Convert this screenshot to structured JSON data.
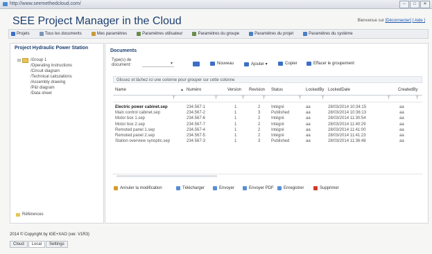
{
  "browser": {
    "url": "http://www.seemethedcloud.com/"
  },
  "window_buttons": [
    "–",
    "□",
    "✕"
  ],
  "app": {
    "title": "SEE Project Manager in the Cloud"
  },
  "welcome": {
    "text": "Bienvenue sur ",
    "user": "[Déconnecter]",
    "logout": "[ Aide ]"
  },
  "menu": [
    {
      "label": "Projets",
      "icon": "projects-icon",
      "color": "#3b6fc7"
    },
    {
      "label": "Tous les documents",
      "icon": "documents-icon",
      "color": "#7b95b8"
    },
    {
      "label": "Mes paramètres",
      "icon": "user-settings-icon",
      "color": "#c89b3b"
    },
    {
      "label": "Paramètres utilisateur",
      "icon": "user-params-icon",
      "color": "#6a8c48"
    },
    {
      "label": "Paramètres du groupe",
      "icon": "group-params-icon",
      "color": "#6a8c48"
    },
    {
      "label": "Paramètres du projet",
      "icon": "project-params-icon",
      "color": "#4b7fc4"
    },
    {
      "label": "Paramètres du système",
      "icon": "system-params-icon",
      "color": "#4b7fc4"
    }
  ],
  "left": {
    "header": "Project Hydraulic Power Station",
    "group": "/Group 1",
    "items": [
      "/Operating instructions",
      "/Circuit diagram",
      "/Technical calculations",
      "/Assembly drawing",
      "/P&I diagram",
      "/Data sheet"
    ],
    "references": "Références"
  },
  "docs": {
    "header": "Documents",
    "type_label": "Type(s) de document:",
    "type_value": "",
    "toolbar": [
      {
        "label": "",
        "icon": "view-icon",
        "color": "#3b6fc7"
      },
      {
        "label": "Nouveau",
        "icon": "new-icon",
        "color": "#3b6fc7"
      },
      {
        "label": "Ajouter ▾",
        "icon": "add-icon",
        "color": "#3b6fc7"
      },
      {
        "label": "Copier",
        "icon": "copy-icon",
        "color": "#3b6fc7"
      },
      {
        "label": "Effacer le groupement",
        "icon": "clear-grouping-icon",
        "color": "#3b6fc7"
      }
    ],
    "group_hint": "Glissez et lâchez ici une colonne pour grouper sur cette colonne",
    "columns": [
      "Name",
      "Numéro",
      "Version",
      "Revision",
      "Status",
      "LockedBy",
      "LockedDate",
      "CreatedBy"
    ],
    "rows": [
      [
        "Electric power cabinet.sep",
        "234.567-1",
        "1",
        "2",
        "Intégré",
        "aa",
        "28/03/2014 10:34:15",
        "aa"
      ],
      [
        "Main control cabinet.sep",
        "234.567-2",
        "1",
        "3",
        "Published",
        "aa",
        "28/03/2014 10:36:13",
        "aa"
      ],
      [
        "Motor box 1.sep",
        "234.567-6",
        "1",
        "2",
        "Intégré",
        "aa",
        "28/03/2014 11:30:54",
        "aa"
      ],
      [
        "Motor box 2.sep",
        "234.567-7",
        "1",
        "2",
        "Intégré",
        "aa",
        "28/03/2014 11:40:29",
        "aa"
      ],
      [
        "Remoted panel 1.sep",
        "234.567-4",
        "1",
        "2",
        "Intégré",
        "aa",
        "28/03/2014 11:41:00",
        "aa"
      ],
      [
        "Remoted panel 2.sep",
        "234.567-5",
        "1",
        "2",
        "Intégré",
        "aa",
        "28/03/2014 11:41:23",
        "aa"
      ],
      [
        "Station overview synoptic.sep",
        "234.567-3",
        "1",
        "3",
        "Published",
        "aa",
        "28/03/2014 11:36:48",
        "aa"
      ]
    ],
    "bottom_toolbar": [
      {
        "label": "Annuler la modification",
        "icon": "undo-icon",
        "color": "#d79a2a"
      },
      {
        "label": "Télécharger",
        "icon": "download-icon",
        "color": "#5b8dd6"
      },
      {
        "label": "Envoyer",
        "icon": "upload-icon",
        "color": "#5b8dd6"
      },
      {
        "label": "Envoyer PDF",
        "icon": "send-pdf-icon",
        "color": "#5b8dd6"
      },
      {
        "label": "Enregistrer",
        "icon": "save-icon",
        "color": "#5b8dd6"
      },
      {
        "label": "Supprimer",
        "icon": "delete-icon",
        "color": "#d23a2a"
      }
    ]
  },
  "footer": {
    "copyright": "2014 © Copyright by IGE+XAO (ver. V1R3)"
  },
  "tabs": [
    "Cloud",
    "Local",
    "Settings"
  ]
}
